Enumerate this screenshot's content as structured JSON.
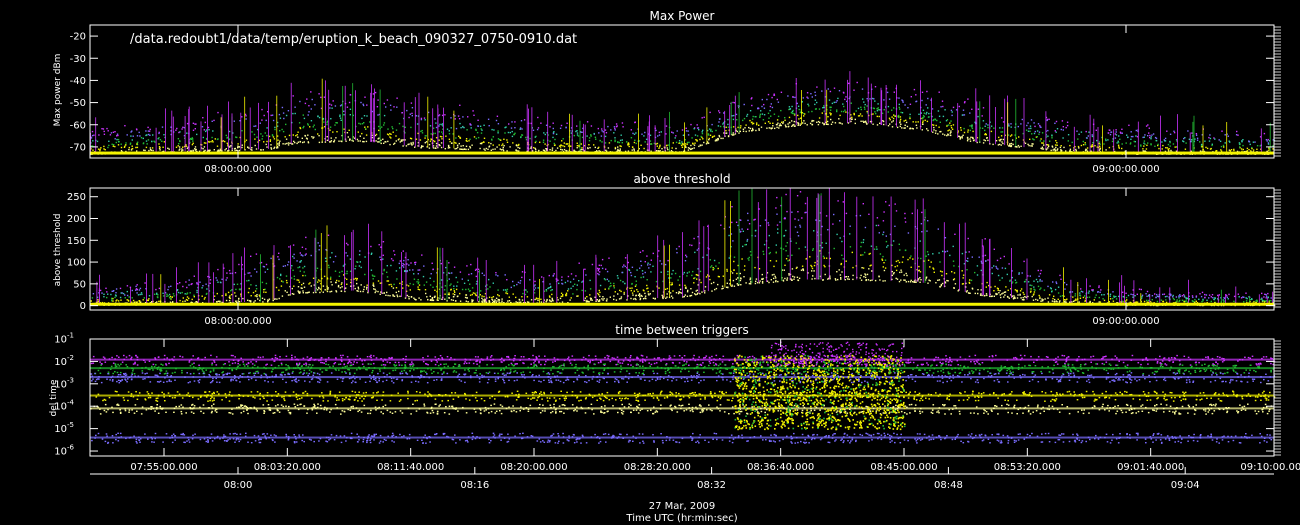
{
  "file_label": "/data.redoubt1/data/temp/eruption_k_beach_090327_0750-0910.dat",
  "colors": {
    "background": "#000000",
    "axis": "#ffffff",
    "magenta": "#cc33ff",
    "blue": "#7a6cff",
    "cyan": "#33ccaa",
    "green": "#22bb33",
    "yellow": "#f4f400",
    "lightyellow": "#ffff99",
    "red": "#ff3333"
  },
  "chart_data": [
    {
      "type": "scatter",
      "title": "Max Power",
      "ylabel": "Max power dBm",
      "ylim": [
        -75,
        -15
      ],
      "yticks": [
        -20,
        -30,
        -40,
        -50,
        -60,
        -70
      ],
      "ytick_labels": [
        "-20",
        "-30",
        "-40",
        "-50",
        "-60",
        "-70"
      ],
      "xlim": [
        "07:50:00",
        "09:10:00"
      ],
      "xticks": [
        {
          "t": "08:00:00",
          "label": "08:00:00.000"
        },
        {
          "t": "09:00:00",
          "label": "09:00:00.000"
        }
      ],
      "series": [
        {
          "color": "magenta",
          "x": [
            "07:50",
            "07:56",
            "08:02",
            "08:04",
            "08:08",
            "08:12",
            "08:20",
            "08:30",
            "08:34",
            "08:38",
            "08:42",
            "08:46",
            "08:50",
            "08:56",
            "09:00",
            "09:06",
            "09:10"
          ],
          "y": [
            -62,
            -58,
            -52,
            -45,
            -44,
            -50,
            -56,
            -60,
            -48,
            -42,
            -41,
            -44,
            -50,
            -58,
            -60,
            -62,
            -63
          ]
        },
        {
          "color": "yellow",
          "x": [
            "07:50",
            "07:56",
            "08:02",
            "08:04",
            "08:08",
            "08:12",
            "08:20",
            "08:30",
            "08:34",
            "08:38",
            "08:42",
            "08:46",
            "08:50",
            "08:56",
            "09:00",
            "09:06",
            "09:10"
          ],
          "y": [
            -73,
            -72,
            -71,
            -68,
            -67,
            -70,
            -72,
            -72,
            -63,
            -60,
            -59,
            -62,
            -68,
            -72,
            -73,
            -73,
            -73
          ]
        }
      ]
    },
    {
      "type": "scatter",
      "title": "above threshold",
      "ylabel": "above threshold",
      "ylim": [
        -10,
        270
      ],
      "yticks": [
        0,
        50,
        100,
        150,
        200,
        250
      ],
      "ytick_labels": [
        "0",
        "50",
        "100",
        "150",
        "200",
        "250"
      ],
      "xlim": [
        "07:50:00",
        "09:10:00"
      ],
      "xticks": [
        {
          "t": "08:00:00",
          "label": "08:00:00.000"
        },
        {
          "t": "09:00:00",
          "label": "09:00:00.000"
        }
      ],
      "series": [
        {
          "color": "magenta",
          "x": [
            "07:50",
            "07:56",
            "08:02",
            "08:04",
            "08:08",
            "08:12",
            "08:20",
            "08:30",
            "08:34",
            "08:38",
            "08:42",
            "08:46",
            "08:50",
            "08:56",
            "09:00",
            "09:06",
            "09:10"
          ],
          "y": [
            40,
            60,
            120,
            160,
            170,
            120,
            70,
            150,
            240,
            250,
            250,
            230,
            150,
            60,
            40,
            30,
            30
          ]
        },
        {
          "color": "yellow",
          "x": [
            "07:50",
            "07:56",
            "08:02",
            "08:04",
            "08:08",
            "08:12",
            "08:20",
            "08:30",
            "08:34",
            "08:38",
            "08:42",
            "08:46",
            "08:50",
            "08:56",
            "09:00",
            "09:06",
            "09:10"
          ],
          "y": [
            2,
            4,
            10,
            30,
            35,
            15,
            5,
            20,
            50,
            60,
            60,
            55,
            25,
            5,
            2,
            2,
            2
          ]
        }
      ]
    },
    {
      "type": "scatter",
      "title": "time between triggers",
      "ylabel": "del time",
      "yscale": "log",
      "ylim": [
        6e-07,
        0.1
      ],
      "yticks": [
        0.1,
        0.01,
        0.001,
        0.0001,
        1e-05,
        1e-06
      ],
      "ytick_labels": [
        {
          "base": "10",
          "exp": "-1"
        },
        {
          "base": "10",
          "exp": "-2"
        },
        {
          "base": "10",
          "exp": "-3"
        },
        {
          "base": "10",
          "exp": "-4"
        },
        {
          "base": "10",
          "exp": "-5"
        },
        {
          "base": "10",
          "exp": "-6"
        }
      ],
      "xlim": [
        "07:50:00",
        "09:10:00"
      ],
      "xticks": [
        {
          "t": "07:55:00",
          "label": "07:55:00.000"
        },
        {
          "t": "08:03:20",
          "label": "08:03:20.000"
        },
        {
          "t": "08:11:40",
          "label": "08:11:40.000"
        },
        {
          "t": "08:20:00",
          "label": "08:20:00.000"
        },
        {
          "t": "08:28:20",
          "label": "08:28:20.000"
        },
        {
          "t": "08:36:40",
          "label": "08:36:40.000"
        },
        {
          "t": "08:45:00",
          "label": "08:45:00.000"
        },
        {
          "t": "08:53:20",
          "label": "08:53:20.000"
        },
        {
          "t": "09:01:40",
          "label": "09:01:40.000"
        },
        {
          "t": "09:10:00",
          "label": "09:10:00.000"
        }
      ],
      "bands": [
        {
          "color": "magenta",
          "y": 0.012
        },
        {
          "color": "green",
          "y": 0.005
        },
        {
          "color": "blue",
          "y": 0.002
        },
        {
          "color": "yellow",
          "y": 0.0003
        },
        {
          "color": "lightyellow",
          "y": 8e-05
        },
        {
          "color": "blue",
          "y": 4e-06
        }
      ]
    }
  ],
  "bottom_axis": {
    "ticks": [
      {
        "t": "08:00",
        "label": "08:00"
      },
      {
        "t": "08:16",
        "label": "08:16"
      },
      {
        "t": "08:32",
        "label": "08:32"
      },
      {
        "t": "08:48",
        "label": "08:48"
      },
      {
        "t": "09:04",
        "label": "09:04"
      }
    ],
    "date_label": "27 Mar, 2009",
    "time_label": "Time UTC (hr:min:sec)"
  }
}
